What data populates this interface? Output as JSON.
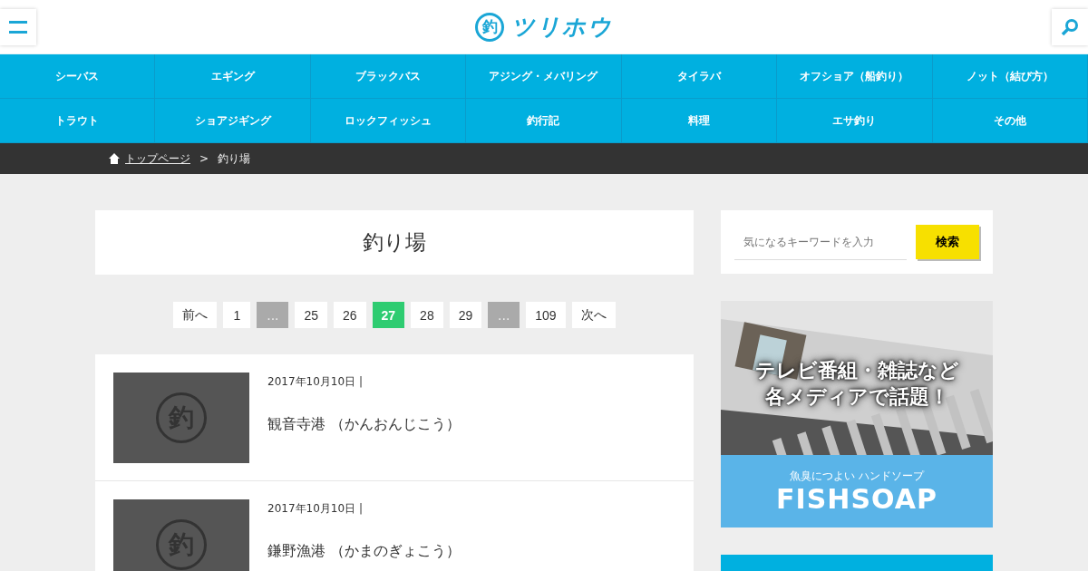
{
  "header": {
    "logo_mark": "釣",
    "logo_text": "ツリホウ"
  },
  "nav": {
    "rows": [
      [
        "シーバス",
        "エギング",
        "ブラックバス",
        "アジング・メバリング",
        "タイラバ",
        "オフショア（船釣り）",
        "ノット（結び方）"
      ],
      [
        "トラウト",
        "ショアジギング",
        "ロックフィッシュ",
        "釣行記",
        "料理",
        "エサ釣り",
        "その他"
      ]
    ]
  },
  "breadcrumb": {
    "home": "トップページ",
    "separator": ">",
    "current": "釣り場"
  },
  "page_title": "釣り場",
  "pagination": [
    {
      "label": "前へ",
      "kind": "link",
      "selected": false
    },
    {
      "label": "1",
      "kind": "link",
      "selected": false
    },
    {
      "label": "...",
      "kind": "gap"
    },
    {
      "label": "25",
      "kind": "link",
      "selected": false
    },
    {
      "label": "26",
      "kind": "link",
      "selected": false
    },
    {
      "label": "27",
      "kind": "link",
      "selected": true
    },
    {
      "label": "28",
      "kind": "link",
      "selected": false
    },
    {
      "label": "29",
      "kind": "link",
      "selected": false
    },
    {
      "label": "...",
      "kind": "gap"
    },
    {
      "label": "109",
      "kind": "link",
      "selected": false
    },
    {
      "label": "次へ",
      "kind": "link",
      "selected": false
    }
  ],
  "posts": [
    {
      "thumbnail_mark": "釣",
      "date": "2017年10月10日 |",
      "title": "観音寺港 （かんおんじこう）"
    },
    {
      "thumbnail_mark": "釣",
      "date": "2017年10月10日 |",
      "title": "鎌野漁港 （かまのぎょこう）"
    }
  ],
  "sidebar": {
    "search": {
      "placeholder": "気になるキーワードを入力",
      "button": "検索"
    },
    "ad": {
      "headline": [
        "テレビ番組・雑誌など",
        "各メディアで話題！"
      ],
      "tagline": "魚臭につよい ハンドソープ",
      "brand": "FISHSOAP"
    }
  }
}
